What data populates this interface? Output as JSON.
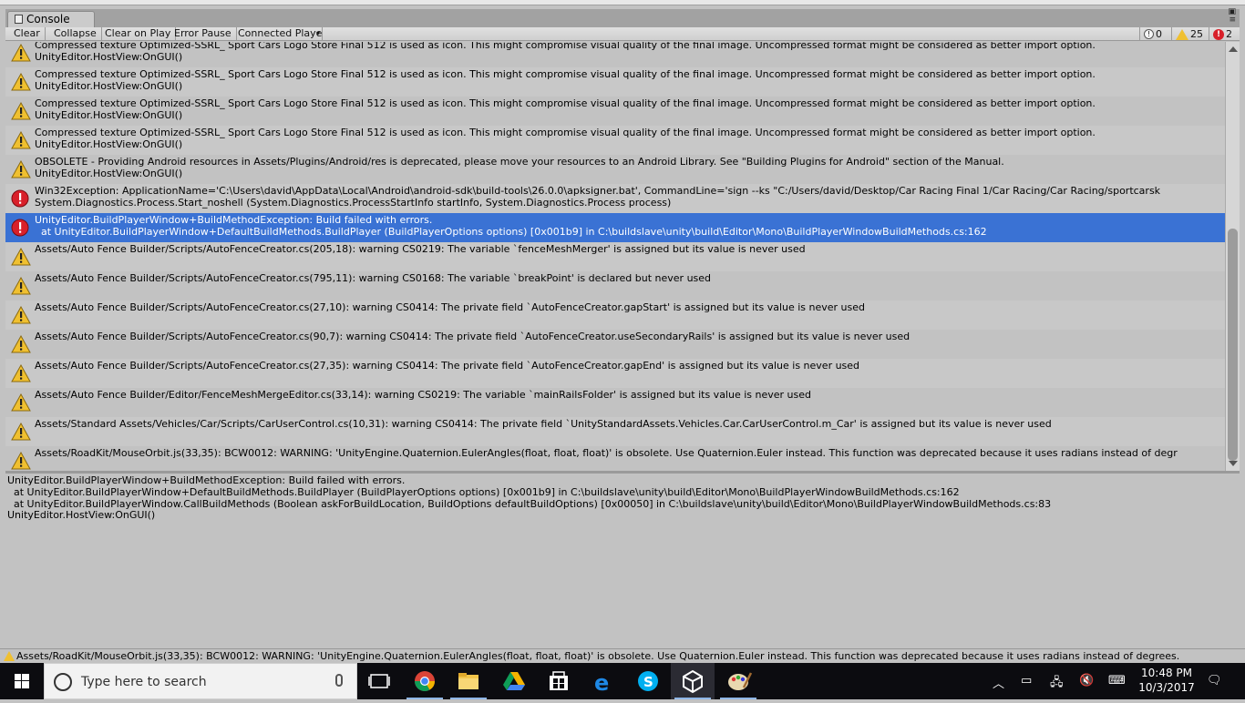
{
  "window": {
    "tab_title": "Console"
  },
  "toolbar": {
    "buttons": [
      "Clear",
      "Collapse",
      "Clear on Play",
      "Error Pause",
      "Connected Player"
    ],
    "counts": {
      "info": "0",
      "warnings": "25",
      "errors": "2"
    }
  },
  "log": {
    "entries": [
      {
        "type": "warning",
        "line1": "Compressed texture Optimized-SSRL_ Sport Cars Logo Store Final 512 is used as icon. This might compromise visual quality of the final image. Uncompressed format might be considered as better import option.",
        "line2": "UnityEditor.HostView:OnGUI()"
      },
      {
        "type": "warning",
        "line1": "Compressed texture Optimized-SSRL_ Sport Cars Logo Store Final 512 is used as icon. This might compromise visual quality of the final image. Uncompressed format might be considered as better import option.",
        "line2": "UnityEditor.HostView:OnGUI()"
      },
      {
        "type": "warning",
        "line1": "Compressed texture Optimized-SSRL_ Sport Cars Logo Store Final 512 is used as icon. This might compromise visual quality of the final image. Uncompressed format might be considered as better import option.",
        "line2": "UnityEditor.HostView:OnGUI()"
      },
      {
        "type": "warning",
        "line1": "Compressed texture Optimized-SSRL_ Sport Cars Logo Store Final 512 is used as icon. This might compromise visual quality of the final image. Uncompressed format might be considered as better import option.",
        "line2": "UnityEditor.HostView:OnGUI()"
      },
      {
        "type": "warning",
        "line1": "OBSOLETE - Providing Android resources in Assets/Plugins/Android/res is deprecated, please move your resources to an Android Library. See \"Building Plugins for Android\" section of the Manual.",
        "line2": "UnityEditor.HostView:OnGUI()"
      },
      {
        "type": "error",
        "line1": "Win32Exception: ApplicationName='C:\\Users\\david\\AppData\\Local\\Android\\android-sdk\\build-tools\\26.0.0\\apksigner.bat', CommandLine='sign --ks \"C:/Users/david/Desktop/Car Racing Final 1/Car Racing/Car Racing/sportcarsk",
        "line2": "System.Diagnostics.Process.Start_noshell (System.Diagnostics.ProcessStartInfo startInfo, System.Diagnostics.Process process)"
      },
      {
        "type": "error",
        "selected": true,
        "line1": "UnityEditor.BuildPlayerWindow+BuildMethodException: Build failed with errors.",
        "line2": "  at UnityEditor.BuildPlayerWindow+DefaultBuildMethods.BuildPlayer (BuildPlayerOptions options) [0x001b9] in C:\\buildslave\\unity\\build\\Editor\\Mono\\BuildPlayerWindowBuildMethods.cs:162"
      },
      {
        "type": "warning",
        "line1": "Assets/Auto Fence Builder/Scripts/AutoFenceCreator.cs(205,18): warning CS0219: The variable `fenceMeshMerger' is assigned but its value is never used",
        "line2": ""
      },
      {
        "type": "warning",
        "line1": "Assets/Auto Fence Builder/Scripts/AutoFenceCreator.cs(795,11): warning CS0168: The variable `breakPoint' is declared but never used",
        "line2": ""
      },
      {
        "type": "warning",
        "line1": "Assets/Auto Fence Builder/Scripts/AutoFenceCreator.cs(27,10): warning CS0414: The private field `AutoFenceCreator.gapStart' is assigned but its value is never used",
        "line2": ""
      },
      {
        "type": "warning",
        "line1": "Assets/Auto Fence Builder/Scripts/AutoFenceCreator.cs(90,7): warning CS0414: The private field `AutoFenceCreator.useSecondaryRails' is assigned but its value is never used",
        "line2": ""
      },
      {
        "type": "warning",
        "line1": "Assets/Auto Fence Builder/Scripts/AutoFenceCreator.cs(27,35): warning CS0414: The private field `AutoFenceCreator.gapEnd' is assigned but its value is never used",
        "line2": ""
      },
      {
        "type": "warning",
        "line1": "Assets/Auto Fence Builder/Editor/FenceMeshMergeEditor.cs(33,14): warning CS0219: The variable `mainRailsFolder' is assigned but its value is never used",
        "line2": ""
      },
      {
        "type": "warning",
        "line1": "Assets/Standard Assets/Vehicles/Car/Scripts/CarUserControl.cs(10,31): warning CS0414: The private field `UnityStandardAssets.Vehicles.Car.CarUserControl.m_Car' is assigned but its value is never used",
        "line2": ""
      },
      {
        "type": "warning",
        "line1": "Assets/RoadKit/MouseOrbit.js(33,35): BCW0012: WARNING: 'UnityEngine.Quaternion.EulerAngles(float, float, float)' is obsolete. Use Quaternion.Euler instead. This function was deprecated because it uses radians instead of degr",
        "line2": ""
      }
    ]
  },
  "detail": {
    "text": "UnityEditor.BuildPlayerWindow+BuildMethodException: Build failed with errors.\n  at UnityEditor.BuildPlayerWindow+DefaultBuildMethods.BuildPlayer (BuildPlayerOptions options) [0x001b9] in C:\\buildslave\\unity\\build\\Editor\\Mono\\BuildPlayerWindowBuildMethods.cs:162\n  at UnityEditor.BuildPlayerWindow.CallBuildMethods (Boolean askForBuildLocation, BuildOptions defaultBuildOptions) [0x00050] in C:\\buildslave\\unity\\build\\Editor\\Mono\\BuildPlayerWindowBuildMethods.cs:83\nUnityEditor.HostView:OnGUI()"
  },
  "statusbar": {
    "text": "Assets/RoadKit/MouseOrbit.js(33,35): BCW0012: WARNING: 'UnityEngine.Quaternion.EulerAngles(float, float, float)' is obsolete. Use Quaternion.Euler instead. This function was deprecated because it uses radians instead of degrees."
  },
  "taskbar": {
    "search_placeholder": "Type here to search",
    "time": "10:48 PM",
    "date": "10/3/2017"
  },
  "colors": {
    "selected_row": "#3a72d4",
    "warning": "#f0c030",
    "error": "#d8202a",
    "taskbar": "#0c0c10"
  }
}
